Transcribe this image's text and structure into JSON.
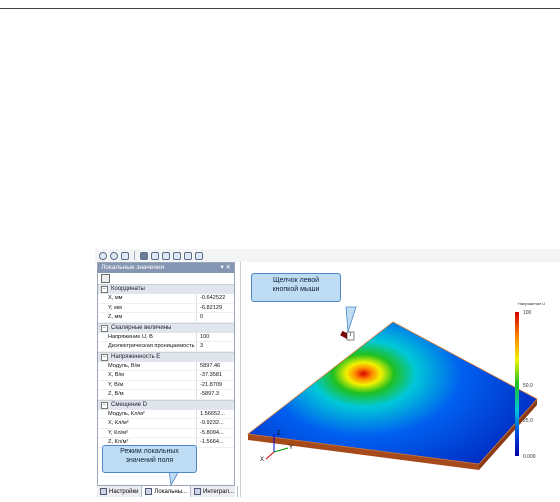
{
  "toolbar": {
    "icons": [
      "zoom-in-icon",
      "zoom-out-icon",
      "fit-icon",
      "view-iso-icon",
      "view-front-icon",
      "view-top-icon",
      "view-side-icon",
      "view-back-icon",
      "view-bottom-icon"
    ]
  },
  "panel": {
    "title": "Локальные значения",
    "title_controls": "▾ ✕",
    "groups": [
      {
        "name": "Координаты",
        "rows": [
          {
            "label": "X, мм",
            "value": "-0.642522"
          },
          {
            "label": "Y, мм",
            "value": "-6.82129"
          },
          {
            "label": "Z, мм",
            "value": "0"
          }
        ]
      },
      {
        "name": "Скалярные величины",
        "rows": [
          {
            "label": "Напряжение U, В",
            "value": "100"
          },
          {
            "label": "Диэлектрическая проницаемость",
            "value": "3"
          }
        ]
      },
      {
        "name": "Напряженность E",
        "rows": [
          {
            "label": "Модуль, В/м",
            "value": "5897.46"
          },
          {
            "label": "X, В/м",
            "value": "-37.3581"
          },
          {
            "label": "Y, В/м",
            "value": "-21.8709"
          },
          {
            "label": "Z, В/м",
            "value": "-5897.3"
          }
        ]
      },
      {
        "name": "Смещение D",
        "rows": [
          {
            "label": "Модуль, Кл/м²",
            "value": "1.56652..."
          },
          {
            "label": "X, Кл/м²",
            "value": "-9.9232..."
          },
          {
            "label": "Y, Кл/м²",
            "value": "-5.8094..."
          },
          {
            "label": "Z, Кл/м²",
            "value": "-1.5664..."
          }
        ]
      }
    ]
  },
  "tabs": [
    {
      "label": "Настройки"
    },
    {
      "label": "Локальны..."
    },
    {
      "label": "Интеграл..."
    }
  ],
  "callouts": {
    "left_click": {
      "line1": "Щелчок левой",
      "line2": "кнопкой мыши"
    },
    "local_mode": {
      "line1": "Режим локальных",
      "line2": "значений поля"
    }
  },
  "legend": {
    "title": "Напряжение U",
    "ticks": [
      "100",
      "50.0",
      "25.0",
      "0.000"
    ],
    "colors": [
      "#d40000",
      "#ff8a00",
      "#f2f200",
      "#20c020",
      "#00c8d8",
      "#0040e0",
      "#0000a0"
    ]
  },
  "axes": {
    "x": "X",
    "y": "Y",
    "z": "Z"
  }
}
